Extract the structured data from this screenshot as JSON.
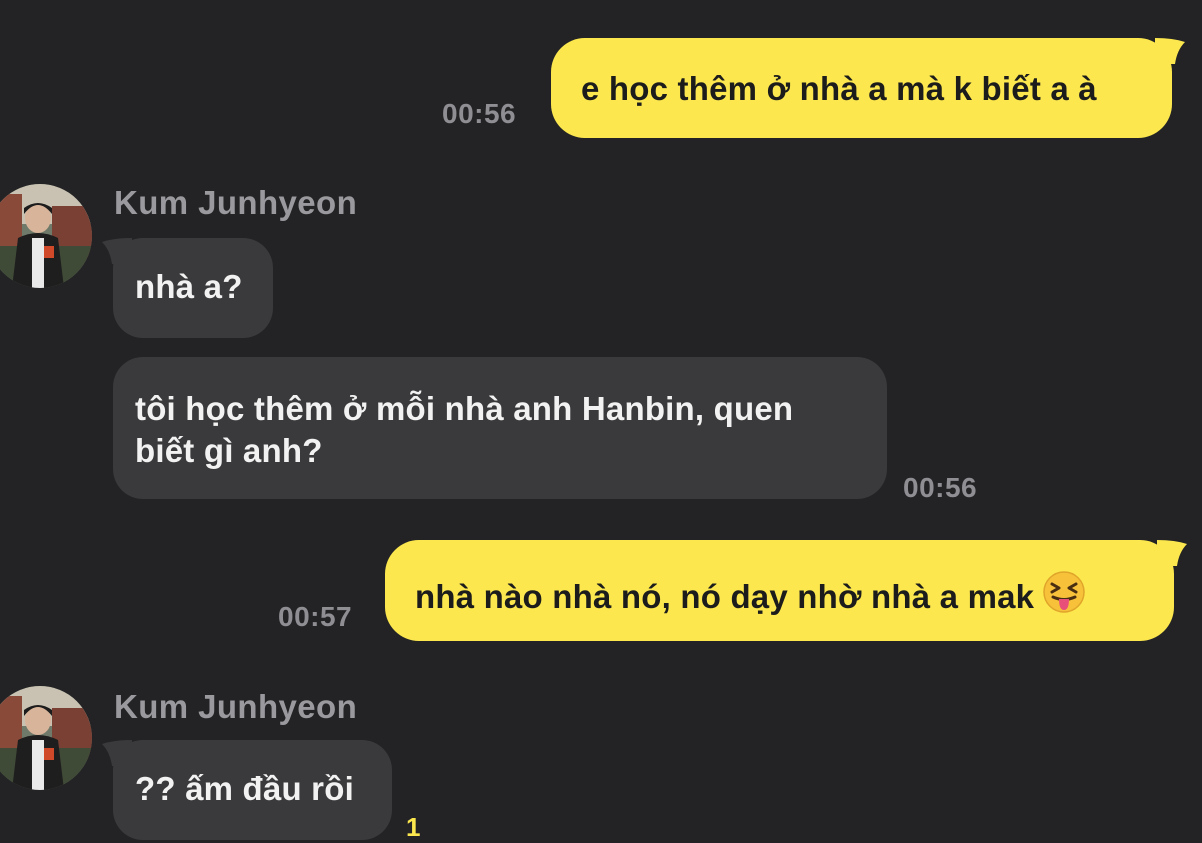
{
  "messages": [
    {
      "side": "mine",
      "text": "e học thêm ở nhà a mà k biết a à",
      "time": "00:56"
    },
    {
      "side": "theirs",
      "sender": "Kum Junhyeon",
      "text": "nhà a?"
    },
    {
      "side": "theirs",
      "line1": "tôi học thêm ở mỗi nhà anh Hanbin, quen",
      "line2": "biết gì anh?",
      "time": "00:56"
    },
    {
      "side": "mine",
      "text": "nhà nào nhà nó, nó dạy nhờ nhà a mak",
      "emoji": "squinting-tongue-emoji",
      "time": "00:57"
    },
    {
      "side": "theirs",
      "sender": "Kum Junhyeon",
      "text": "?? ấm đầu rồi",
      "unread": "1"
    }
  ],
  "colors": {
    "background": "#232325",
    "mine_bubble": "#fce84e",
    "theirs_bubble": "#3a3a3c",
    "timestamp": "#8e8e93",
    "sender_name": "#9a9a9e",
    "unread_count": "#fce84e"
  }
}
